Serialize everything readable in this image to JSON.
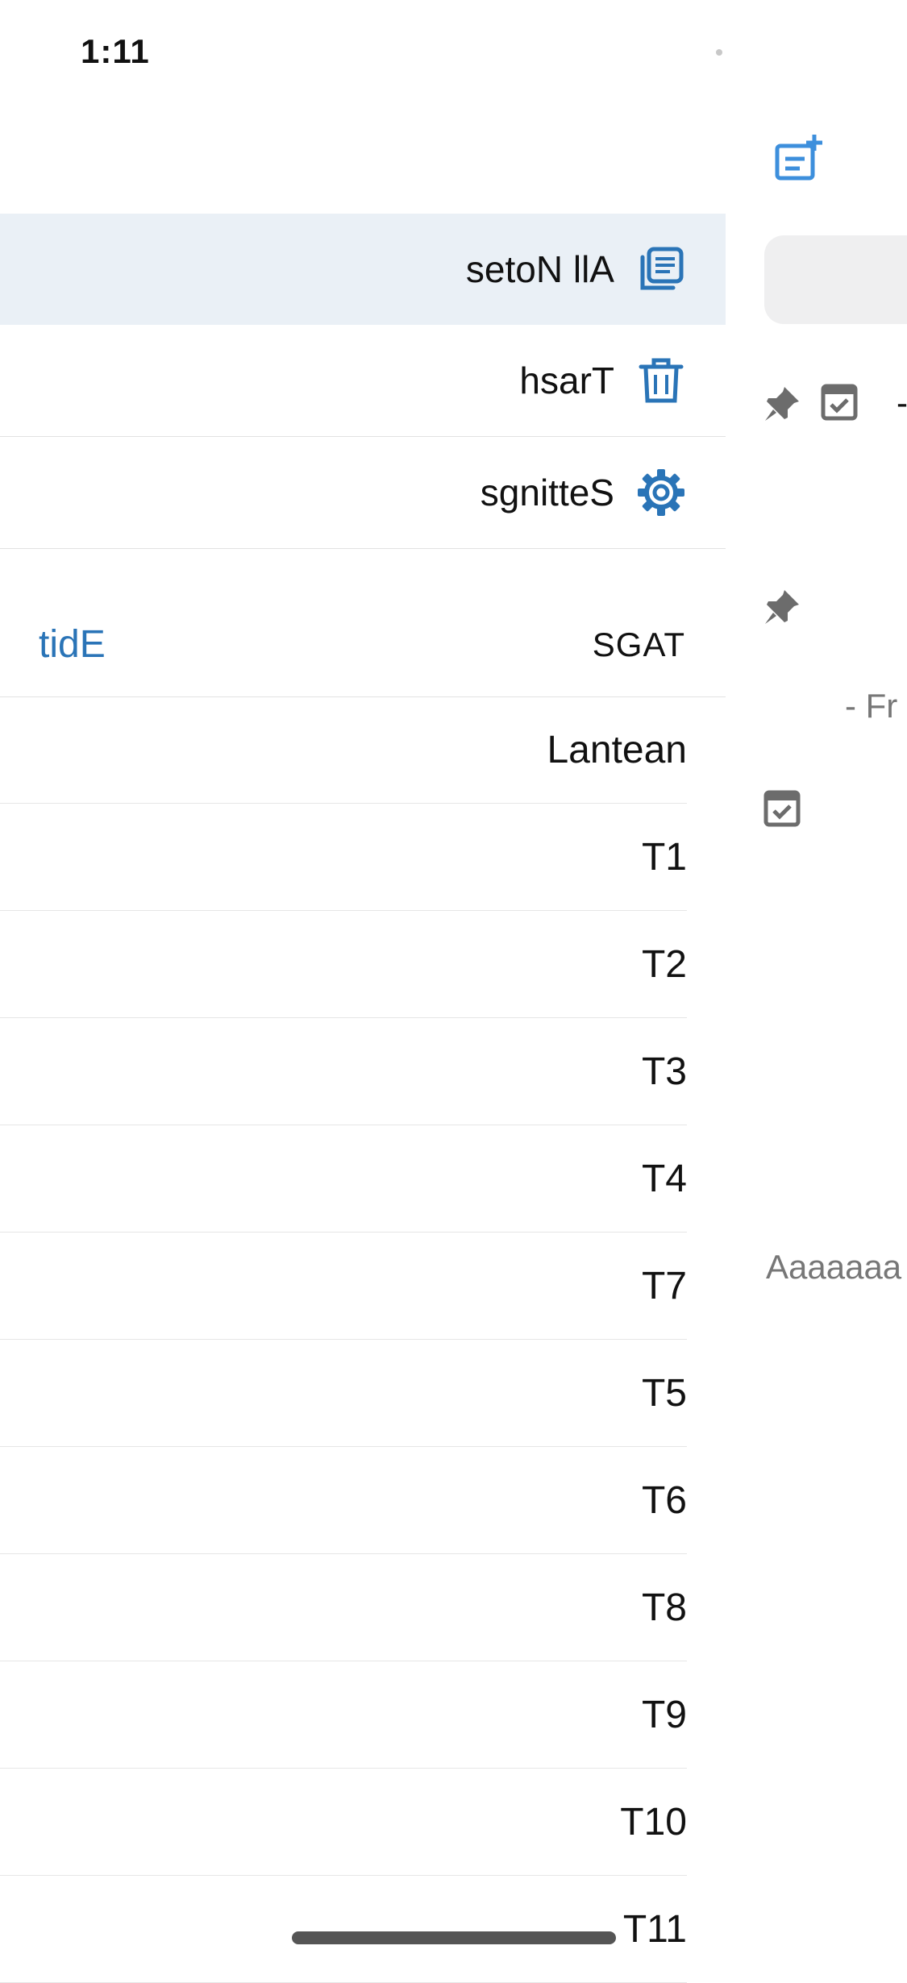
{
  "status_bar": {
    "time": "1:11"
  },
  "drawer": {
    "items": [
      {
        "label": "setoN llA",
        "icon": "notes-stack-icon",
        "selected": true
      },
      {
        "label": "hsarT",
        "icon": "trash-icon",
        "selected": false
      },
      {
        "label": "sgnitteS",
        "icon": "gear-icon",
        "selected": false
      }
    ],
    "tags_header": {
      "edit_label": "tidE",
      "title": "SGAT"
    },
    "tags": [
      "Lantean",
      "T1",
      "T2",
      "T3",
      "T4",
      "T7",
      "T5",
      "T6",
      "T8",
      "T9",
      "T10",
      "T11"
    ]
  },
  "background_screen": {
    "peek_text_1": "- Fr",
    "peek_text_2": "Aaaaaaa"
  },
  "colors": {
    "accent": "#2a74b7",
    "selected_row": "#eaf0f6",
    "icon_gray": "#7a7a7a"
  }
}
